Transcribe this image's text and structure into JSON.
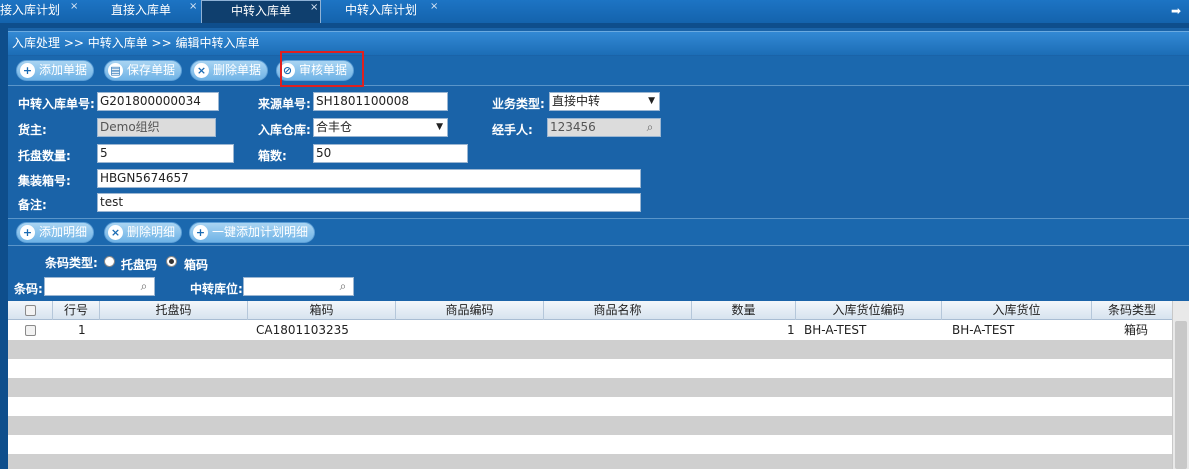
{
  "tabs": [
    {
      "label": "接入库计划",
      "close": "×"
    },
    {
      "label": "直接入库单",
      "close": "×"
    },
    {
      "label": "中转入库单",
      "close": "×",
      "active": true
    },
    {
      "label": "中转入库计划",
      "close": "×"
    }
  ],
  "breadcrumb": "入库处理 >> 中转入库单 >> 编辑中转入库单",
  "toolbar": {
    "add": "添加单据",
    "save": "保存单据",
    "delete": "删除单据",
    "audit": "审核单据"
  },
  "form": {
    "transfer_no_label": "中转入库单号:",
    "transfer_no": "G201800000034",
    "source_no_label": "来源单号:",
    "source_no": "SH1801100008",
    "biz_type_label": "业务类型:",
    "biz_type": "直接中转",
    "owner_label": "货主:",
    "owner": "Demo组织",
    "warehouse_label": "入库仓库:",
    "warehouse": "合丰仓",
    "handler_label": "经手人:",
    "handler": "123456",
    "pallet_qty_label": "托盘数量:",
    "pallet_qty": "5",
    "box_qty_label": "箱数:",
    "box_qty": "50",
    "container_label": "集装箱号:",
    "container": "HBGN5674657",
    "remark_label": "备注:",
    "remark": "test"
  },
  "detail_toolbar": {
    "add": "添加明细",
    "delete": "删除明细",
    "add_plan": "一键添加计划明细"
  },
  "filter": {
    "barcode_type_label": "条码类型:",
    "opt_pallet": "托盘码",
    "opt_box": "箱码",
    "barcode_label": "条码:",
    "location_label": "中转库位:"
  },
  "table": {
    "headers": [
      "行号",
      "托盘码",
      "箱码",
      "商品编码",
      "商品名称",
      "数量",
      "入库货位编码",
      "入库货位",
      "条码类型"
    ],
    "rows": [
      {
        "no": "1",
        "pallet": "",
        "box": "CA1801103235",
        "sku": "",
        "name": "",
        "qty": "1",
        "loc_code": "BH-A-TEST",
        "loc": "BH-A-TEST",
        "type": "箱码"
      }
    ]
  }
}
